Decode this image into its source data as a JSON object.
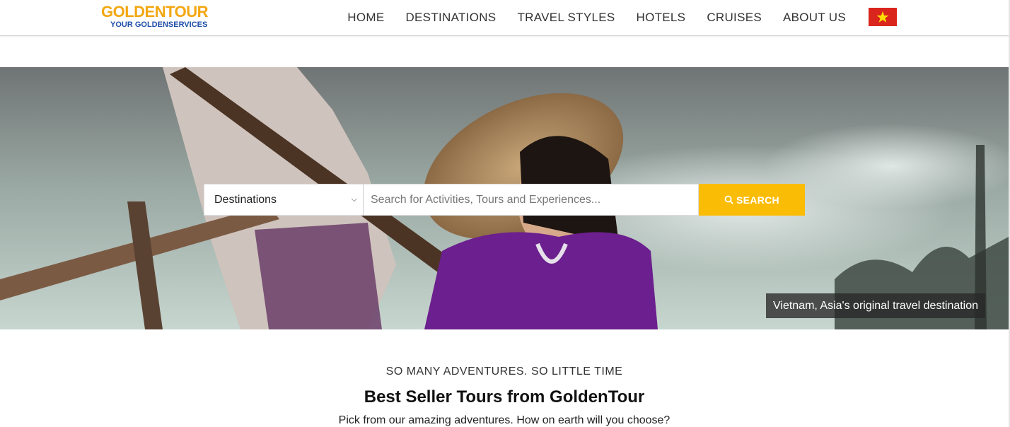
{
  "header": {
    "logo": {
      "main": "GOLDENTOUR",
      "sub": "YOUR GOLDENSERVICES"
    },
    "nav": [
      {
        "label": "HOME"
      },
      {
        "label": "DESTINATIONS"
      },
      {
        "label": "TRAVEL STYLES"
      },
      {
        "label": "HOTELS"
      },
      {
        "label": "CRUISES"
      },
      {
        "label": "ABOUT US"
      }
    ],
    "language_flag_icon": "vietnam-flag-icon"
  },
  "hero": {
    "search": {
      "destination_value": "Destinations",
      "placeholder": "Search for Activities, Tours and Experiences...",
      "button_label": "SEARCH",
      "button_icon": "search-icon"
    },
    "caption": "Vietnam, Asia's original travel destination"
  },
  "intro": {
    "eyebrow": "SO MANY ADVENTURES. SO LITTLE TIME",
    "title": "Best Seller Tours from GoldenTour",
    "subtitle": "Pick from our amazing adventures. How on earth will you choose?"
  },
  "colors": {
    "brand_gold": "#f3a712",
    "brand_blue": "#1f4fa8",
    "search_button": "#fbbc05",
    "flag_red": "#da251d",
    "flag_star": "#ffde00"
  }
}
